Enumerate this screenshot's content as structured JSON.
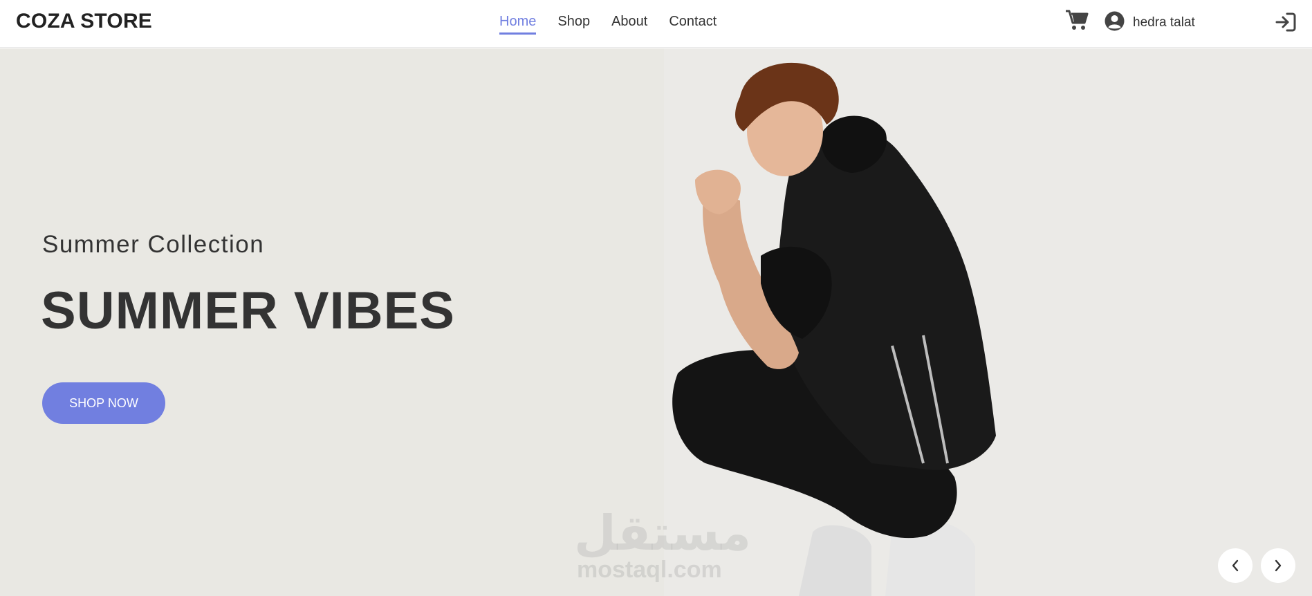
{
  "header": {
    "brand": "COZA STORE",
    "nav": [
      {
        "label": "Home",
        "active": true
      },
      {
        "label": "Shop",
        "active": false
      },
      {
        "label": "About",
        "active": false
      },
      {
        "label": "Contact",
        "active": false
      }
    ],
    "user_name": "hedra talat",
    "icons": [
      "cart-icon",
      "user-circle-icon",
      "sign-in-icon"
    ]
  },
  "hero": {
    "subtitle": "Summer Collection",
    "title": "SUMMER VIBES",
    "button_label": "SHOP NOW",
    "watermark_arabic": "مستقل",
    "watermark_text": "mostaql.com"
  },
  "colors": {
    "accent": "#717fe0",
    "text_dark": "#333333",
    "hero_bg": "#e9e8e3"
  }
}
